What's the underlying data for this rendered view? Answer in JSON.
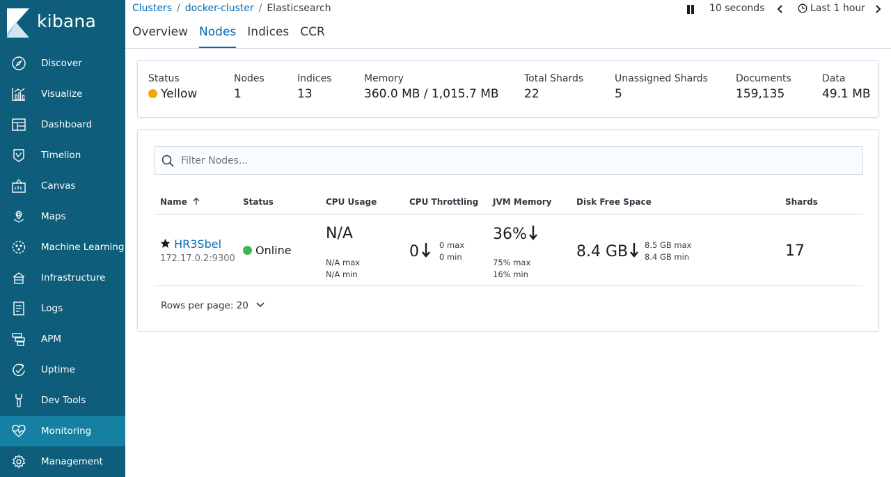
{
  "logo": {
    "text": "kibana"
  },
  "sidebar": {
    "items": [
      {
        "label": "Discover",
        "icon": "compass-icon"
      },
      {
        "label": "Visualize",
        "icon": "visualize-icon"
      },
      {
        "label": "Dashboard",
        "icon": "dashboard-icon"
      },
      {
        "label": "Timelion",
        "icon": "timelion-icon"
      },
      {
        "label": "Canvas",
        "icon": "canvas-icon"
      },
      {
        "label": "Maps",
        "icon": "maps-icon"
      },
      {
        "label": "Machine Learning",
        "icon": "machine-learning-icon"
      },
      {
        "label": "Infrastructure",
        "icon": "infrastructure-icon"
      },
      {
        "label": "Logs",
        "icon": "logs-icon"
      },
      {
        "label": "APM",
        "icon": "apm-icon"
      },
      {
        "label": "Uptime",
        "icon": "uptime-icon"
      },
      {
        "label": "Dev Tools",
        "icon": "wrench-icon"
      },
      {
        "label": "Monitoring",
        "icon": "heartbeat-icon",
        "active": true
      },
      {
        "label": "Management",
        "icon": "gear-icon"
      }
    ]
  },
  "breadcrumbs": {
    "clusters": "Clusters",
    "cluster": "docker-cluster",
    "current": "Elasticsearch",
    "sep": "/"
  },
  "tabs": {
    "overview": "Overview",
    "nodes": "Nodes",
    "indices": "Indices",
    "ccr": "CCR"
  },
  "timebar": {
    "interval": "10 seconds",
    "range": "Last 1 hour"
  },
  "summary": {
    "status_label": "Status",
    "status_value": "Yellow",
    "status_color": "#f5a700",
    "nodes_label": "Nodes",
    "nodes_value": "1",
    "indices_label": "Indices",
    "indices_value": "13",
    "memory_label": "Memory",
    "memory_value": "360.0 MB / 1,015.7 MB",
    "total_shards_label": "Total Shards",
    "total_shards_value": "22",
    "unassigned_label": "Unassigned Shards",
    "unassigned_value": "5",
    "documents_label": "Documents",
    "documents_value": "159,135",
    "data_label": "Data",
    "data_value": "49.1 MB"
  },
  "filter": {
    "placeholder": "Filter Nodes..."
  },
  "table": {
    "headers": {
      "name": "Name",
      "status": "Status",
      "cpu": "CPU Usage",
      "throttling": "CPU Throttling",
      "jvm": "JVM Memory",
      "disk": "Disk Free Space",
      "shards": "Shards"
    },
    "row": {
      "name": "HR3Sbel",
      "address": "172.17.0.2:9300",
      "status": "Online",
      "status_color": "#3cb94a",
      "cpu_value": "N/A",
      "cpu_max": "N/A max",
      "cpu_min": "N/A min",
      "throttling_value": "0",
      "throttling_max": "0 max",
      "throttling_min": "0 min",
      "jvm_value": "36%",
      "jvm_max": "75% max",
      "jvm_min": "16% min",
      "disk_value": "8.4 GB",
      "disk_max": "8.5 GB max",
      "disk_min": "8.4 GB min",
      "shards": "17"
    }
  },
  "pagination": {
    "rows_per_page": "Rows per page: 20"
  }
}
